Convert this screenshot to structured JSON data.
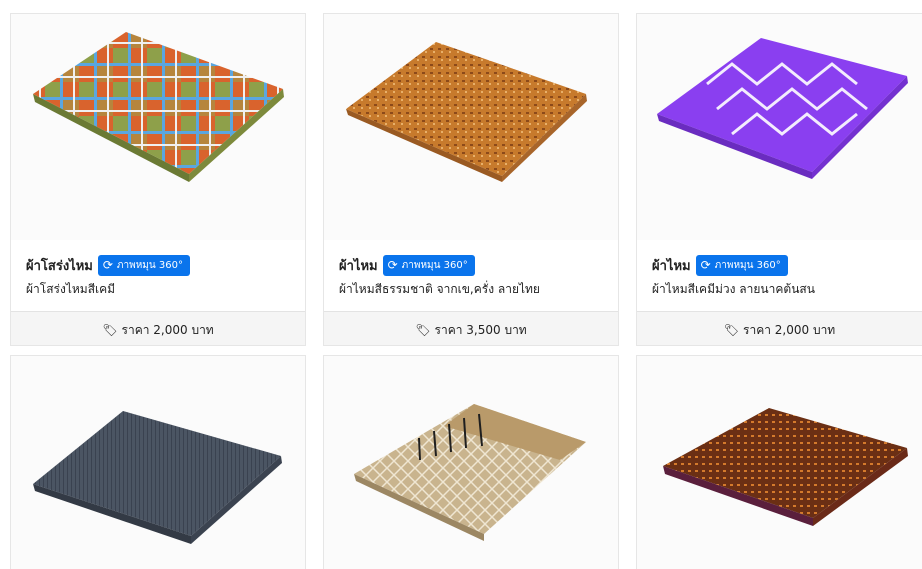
{
  "products": [
    {
      "name": "ผ้าโสร่งไหม",
      "badge": "ภาพหมุน 360°",
      "desc": "ผ้าโสร่งไหมสีเคมี",
      "price": "ราคา 2,000 บาท"
    },
    {
      "name": "ผ้าไหม",
      "badge": "ภาพหมุน 360°",
      "desc": "ผ้าไหมสีธรรมชาติ จากเข,ครั่ง ลายไทย",
      "price": "ราคา 3,500 บาท"
    },
    {
      "name": "ผ้าไหม",
      "badge": "ภาพหมุน 360°",
      "desc": "ผ้าไหมสีเคมีม่วง ลายนาคต้นสน",
      "price": "ราคา 2,000 บาท"
    }
  ],
  "icons": {
    "badge": "rotate-icon",
    "price": "tag-icon"
  },
  "colors": {
    "badge": "#0a74ec",
    "footer": "#f5f5f5"
  }
}
